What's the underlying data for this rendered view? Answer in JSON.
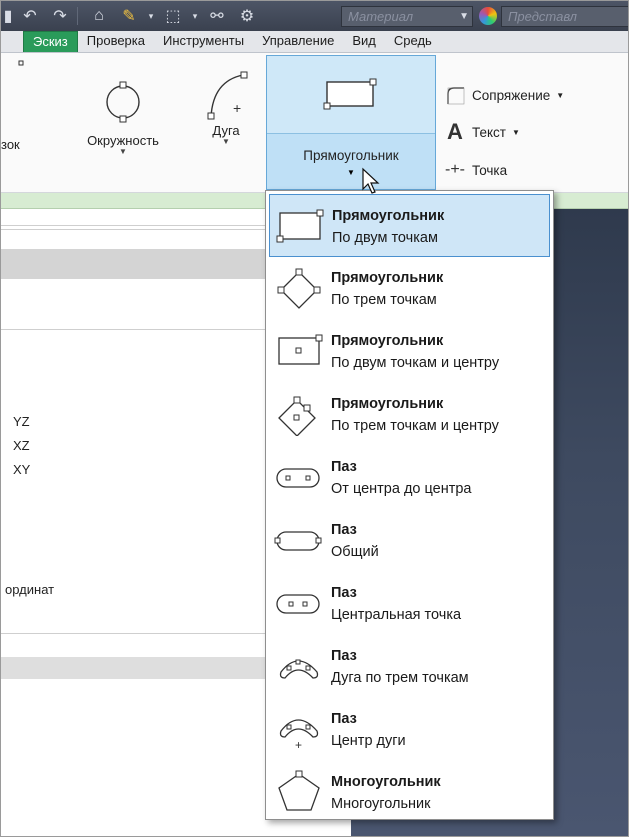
{
  "toolbar": {
    "material_combo": "Материал",
    "appearance_combo": "Представл"
  },
  "tabs": [
    "Эскиз",
    "Проверка",
    "Инструменты",
    "Управление",
    "Вид",
    "Средь"
  ],
  "ribbon": {
    "partial_left_label": "зок",
    "circle_label": "Окружность",
    "arc_label": "Дуга",
    "rectangle_label": "Прямоугольник",
    "fillet_label": "Сопряжение",
    "text_label": "Текст",
    "point_label": "Точка"
  },
  "browser": {
    "planes": [
      "YZ",
      "XZ",
      "XY"
    ],
    "coords_label": "ординат"
  },
  "menu": {
    "items": [
      {
        "title": "Прямоугольник",
        "subtitle": "По двум точкам",
        "icon": "rectangle-two-point-icon",
        "selected": true
      },
      {
        "title": "Прямоугольник",
        "subtitle": "По трем точкам",
        "icon": "rectangle-three-point-icon"
      },
      {
        "title": "Прямоугольник",
        "subtitle": "По двум точкам и центру",
        "icon": "rectangle-two-point-center-icon"
      },
      {
        "title": "Прямоугольник",
        "subtitle": "По трем точкам и центру",
        "icon": "rectangle-three-point-center-icon"
      },
      {
        "title": "Паз",
        "subtitle": "От центра до центра",
        "icon": "slot-center-to-center-icon"
      },
      {
        "title": "Паз",
        "subtitle": "Общий",
        "icon": "slot-overall-icon"
      },
      {
        "title": "Паз",
        "subtitle": "Центральная точка",
        "icon": "slot-center-point-icon"
      },
      {
        "title": "Паз",
        "subtitle": "Дуга по трем точкам",
        "icon": "slot-three-point-arc-icon"
      },
      {
        "title": "Паз",
        "subtitle": "Центр дуги",
        "icon": "slot-center-arc-icon"
      },
      {
        "title": "Многоугольник",
        "subtitle": "Многоугольник",
        "icon": "polygon-icon"
      }
    ]
  },
  "colors": {
    "active_tab": "#2a9b5a",
    "selected_item": "#cfe6f7",
    "selected_border": "#4a90cf",
    "viewport": "#3e4a60"
  }
}
